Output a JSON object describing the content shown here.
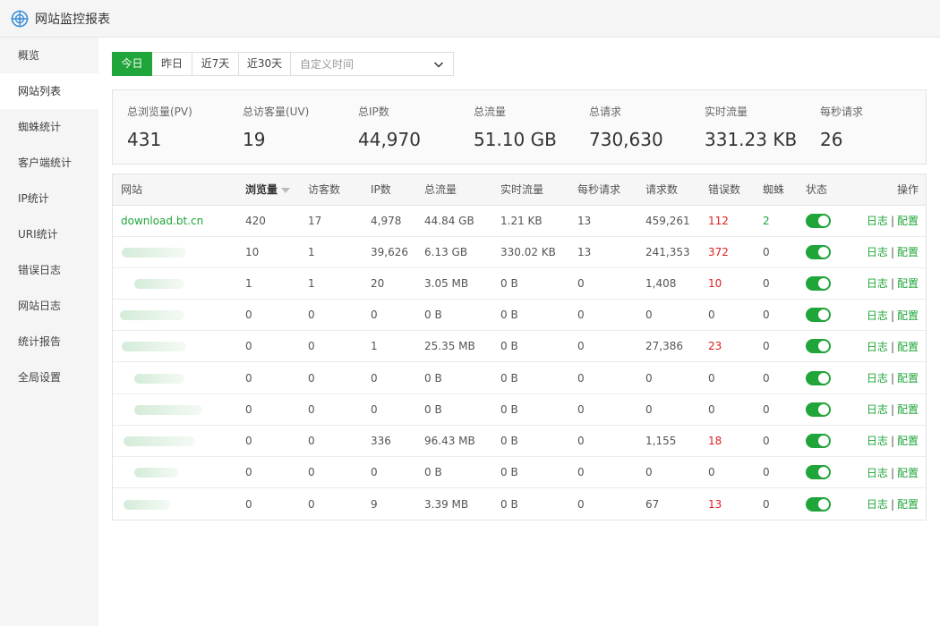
{
  "app": {
    "title": "网站监控报表"
  },
  "sidebar": {
    "items": [
      {
        "label": "概览",
        "active": false
      },
      {
        "label": "网站列表",
        "active": true
      },
      {
        "label": "蜘蛛统计",
        "active": false
      },
      {
        "label": "客户端统计",
        "active": false
      },
      {
        "label": "IP统计",
        "active": false
      },
      {
        "label": "URI统计",
        "active": false
      },
      {
        "label": "错误日志",
        "active": false
      },
      {
        "label": "网站日志",
        "active": false
      },
      {
        "label": "统计报告",
        "active": false
      },
      {
        "label": "全局设置",
        "active": false
      }
    ]
  },
  "filter": {
    "buttons": [
      {
        "label": "今日",
        "active": true
      },
      {
        "label": "昨日",
        "active": false
      },
      {
        "label": "近7天",
        "active": false
      },
      {
        "label": "近30天",
        "active": false
      }
    ],
    "custom_placeholder": "自定义时间"
  },
  "summary": [
    {
      "label": "总浏览量(PV)",
      "value": "431"
    },
    {
      "label": "总访客量(UV)",
      "value": "19"
    },
    {
      "label": "总IP数",
      "value": "44,970"
    },
    {
      "label": "总流量",
      "value": "51.10 GB"
    },
    {
      "label": "总请求",
      "value": "730,630"
    },
    {
      "label": "实时流量",
      "value": "331.23 KB"
    },
    {
      "label": "每秒请求",
      "value": "26"
    }
  ],
  "table": {
    "headers": {
      "site": "网站",
      "pv": "浏览量",
      "uv": "访客数",
      "ip": "IP数",
      "traffic": "总流量",
      "realtime": "实时流量",
      "qps": "每秒请求",
      "requests": "请求数",
      "errors": "错误数",
      "spider": "蜘蛛",
      "status": "状态",
      "ops": "操作"
    },
    "log_label": "日志",
    "config_label": "配置",
    "separator": "|",
    "rows": [
      {
        "site": "download.bt.cn",
        "pv": "420",
        "uv": "17",
        "ip": "4,978",
        "traffic": "44.84 GB",
        "realtime": "1.21 KB",
        "qps": "13",
        "requests": "459,261",
        "errors": "112",
        "spider": "2",
        "status": true
      },
      {
        "site": "",
        "pv": "10",
        "uv": "1",
        "ip": "39,626",
        "traffic": "6.13 GB",
        "realtime": "330.02 KB",
        "qps": "13",
        "requests": "241,353",
        "errors": "372",
        "spider": "0",
        "status": true
      },
      {
        "site": "",
        "pv": "1",
        "uv": "1",
        "ip": "20",
        "traffic": "3.05 MB",
        "realtime": "0 B",
        "qps": "0",
        "requests": "1,408",
        "errors": "10",
        "spider": "0",
        "status": true
      },
      {
        "site": "",
        "pv": "0",
        "uv": "0",
        "ip": "0",
        "traffic": "0 B",
        "realtime": "0 B",
        "qps": "0",
        "requests": "0",
        "errors": "0",
        "spider": "0",
        "status": true
      },
      {
        "site": "",
        "pv": "0",
        "uv": "0",
        "ip": "1",
        "traffic": "25.35 MB",
        "realtime": "0 B",
        "qps": "0",
        "requests": "27,386",
        "errors": "23",
        "spider": "0",
        "status": true
      },
      {
        "site": "",
        "pv": "0",
        "uv": "0",
        "ip": "0",
        "traffic": "0 B",
        "realtime": "0 B",
        "qps": "0",
        "requests": "0",
        "errors": "0",
        "spider": "0",
        "status": true
      },
      {
        "site": "",
        "pv": "0",
        "uv": "0",
        "ip": "0",
        "traffic": "0 B",
        "realtime": "0 B",
        "qps": "0",
        "requests": "0",
        "errors": "0",
        "spider": "0",
        "status": true
      },
      {
        "site": "",
        "pv": "0",
        "uv": "0",
        "ip": "336",
        "traffic": "96.43 MB",
        "realtime": "0 B",
        "qps": "0",
        "requests": "1,155",
        "errors": "18",
        "spider": "0",
        "status": true
      },
      {
        "site": "",
        "pv": "0",
        "uv": "0",
        "ip": "0",
        "traffic": "0 B",
        "realtime": "0 B",
        "qps": "0",
        "requests": "0",
        "errors": "0",
        "spider": "0",
        "status": true
      },
      {
        "site": "",
        "pv": "0",
        "uv": "0",
        "ip": "9",
        "traffic": "3.39 MB",
        "realtime": "0 B",
        "qps": "0",
        "requests": "67",
        "errors": "13",
        "spider": "0",
        "status": true
      }
    ]
  },
  "colors": {
    "accent": "#20a53a",
    "error": "#e02020",
    "sidebar_bg": "#f5f5f5"
  }
}
